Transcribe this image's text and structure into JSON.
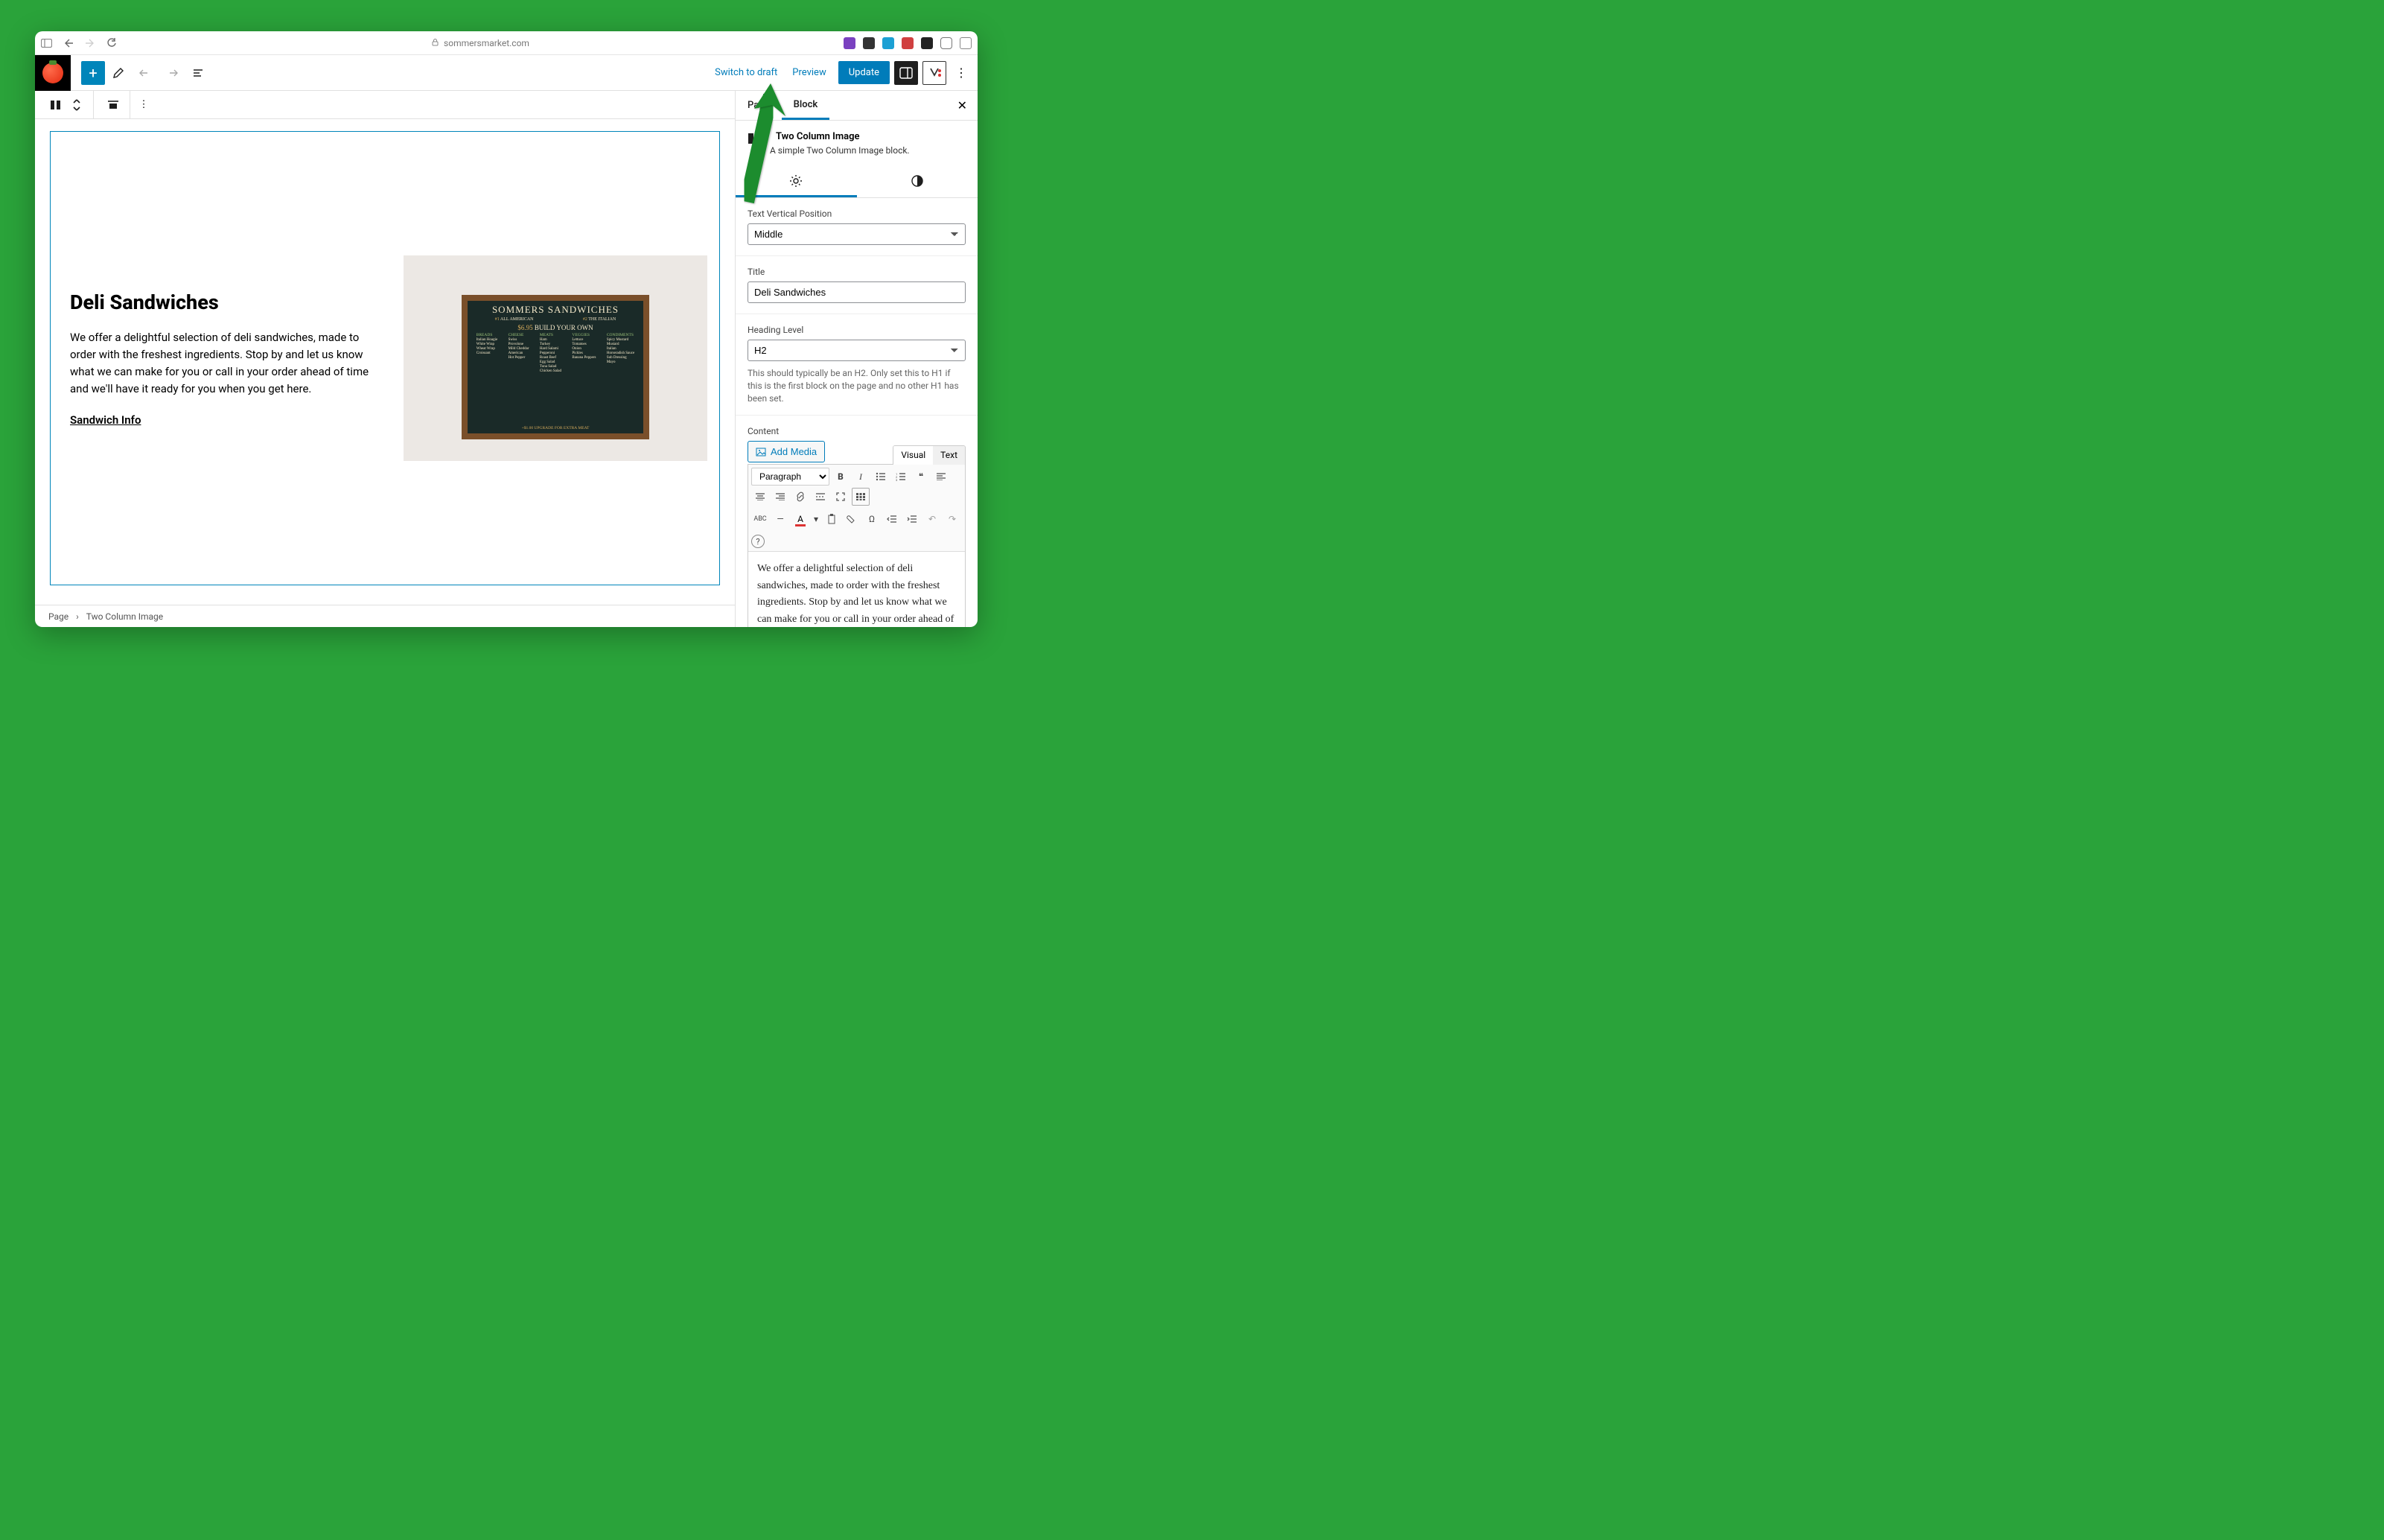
{
  "browser": {
    "url": "sommersmarket.com"
  },
  "toolbar": {
    "switch_draft": "Switch to draft",
    "preview": "Preview",
    "update": "Update"
  },
  "canvas": {
    "heading": "Deli Sandwiches",
    "paragraph": "We offer a delightful selection of deli sandwiches, made to order with the freshest ingredients. Stop by and let us know what we can make for you or call in your order ahead of time and we'll have it ready for you when you get here.",
    "link_text": "Sandwich Info",
    "board": {
      "title": "SOMMERS SANDWICHES",
      "item1_num": "#1",
      "item1_name": "ALL AMERICAN",
      "item2_num": "#2",
      "item2_name": "THE ITALIAN",
      "price": "$6.95",
      "byo": "BUILD YOUR OWN",
      "upgrade": "+$1.00 UPGRADE FOR EXTRA MEAT",
      "heads": {
        "breads": "BREADS",
        "cheese": "CHEESE",
        "meats": "MEATS",
        "veggies": "VEGGIES",
        "condiments": "CONDIMENTS"
      },
      "cols": {
        "breads": [
          "Italian Hoagie",
          "White Wrap",
          "Wheat Wrap",
          "Croissant"
        ],
        "cheese": [
          "Swiss",
          "Provolone",
          "Mild Cheddar",
          "American",
          "Hot Pepper"
        ],
        "meats": [
          "Ham",
          "Turkey",
          "Hard Salami",
          "Pepperoni",
          "Roast Beef",
          "Egg Salad",
          "Tuna Salad",
          "Chicken Salad"
        ],
        "veggies": [
          "Lettuce",
          "Tomatoes",
          "Onion",
          "Pickles",
          "Banana Peppers"
        ],
        "condiments": [
          "Spicy Mustard",
          "Mustard",
          "Italian",
          "Horseradish Sauce",
          "Sub Dressing",
          "Mayo"
        ]
      }
    }
  },
  "breadcrumb": {
    "root": "Page",
    "current": "Two Column Image"
  },
  "sidebar": {
    "tabs": {
      "page": "Page",
      "block": "Block"
    },
    "block_name": "Two Column Image",
    "block_desc": "A simple Two Column Image block.",
    "panels": {
      "text_pos": {
        "label": "Text Vertical Position",
        "value": "Middle"
      },
      "title": {
        "label": "Title",
        "value": "Deli Sandwiches"
      },
      "heading_level": {
        "label": "Heading Level",
        "value": "H2",
        "help": "This should typically be an H2. Only set this to H1 if this is the first block on the page and no other H1 has been set."
      },
      "content": {
        "label": "Content",
        "add_media": "Add Media",
        "visual": "Visual",
        "text": "Text",
        "format_select": "Paragraph",
        "body": "We offer a delightful selection of deli sandwiches, made to order with the freshest ingredients. Stop by and let us know what we can make for you or call in your order ahead of time and we'll have it ready for you when you get"
      }
    }
  }
}
